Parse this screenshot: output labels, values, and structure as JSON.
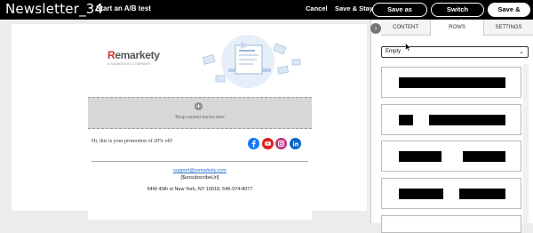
{
  "header": {
    "title": "Newsletter_34",
    "ab_test_label": "Start an A/B test",
    "cancel_label": "Cancel",
    "save_stay_label": "Save & Stay",
    "save_template_label": "Save as Template",
    "switch_template_label": "Switch Template",
    "save_close_label": "Save & Close"
  },
  "email": {
    "logo_text_r": "R",
    "logo_text_rest": "emarkety",
    "logo_subtitle": "A NAMOGOO COMPANY",
    "drop_zone_text": "Drop content blocks here",
    "promo_text": "Hi, this is your promotion of 20% off!",
    "support_email": "support@remarkety.com",
    "unsubscribe_text": "{$unsubscribeUrl}",
    "address_text": "54W 40th st New York, NY 10018, 646-974-8077",
    "social_icons": [
      "facebook-icon",
      "youtube-icon",
      "instagram-icon",
      "linkedin-icon"
    ],
    "colors": {
      "brand_red": "#d0312d",
      "link": "#2a6fd0",
      "facebook": "#1877f2",
      "youtube": "#e02020",
      "instagram": "#c13584",
      "linkedin": "#0a66c2"
    }
  },
  "panel": {
    "tabs": [
      {
        "label": "CONTENT",
        "active": false
      },
      {
        "label": "ROWS",
        "active": true
      },
      {
        "label": "SETTINGS",
        "active": false
      }
    ],
    "rows_select_value": "Empty",
    "row_layouts": [
      "1-column",
      "2-column-1-3",
      "2-column",
      "2-column-wide"
    ]
  }
}
